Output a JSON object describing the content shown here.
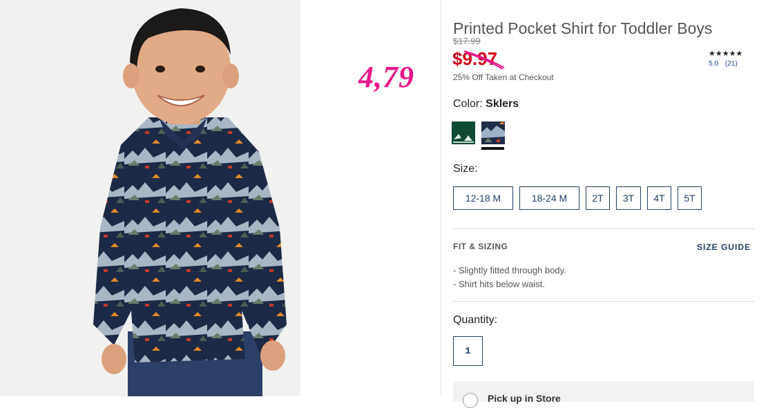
{
  "annotation": {
    "handwritten_price": "4,79"
  },
  "product": {
    "title": "Printed Pocket Shirt for Toddler Boys",
    "was_price": "$17.99",
    "sale_price": "$9.97",
    "promo": "25% Off Taken at Checkout",
    "sale_color": "#d0021b"
  },
  "rating": {
    "stars": "★★★★★",
    "score": "5.0",
    "count": "(21)"
  },
  "color": {
    "label": "Color:",
    "selected": "Sklers",
    "swatches": [
      {
        "name": "green-swatch",
        "selected": false
      },
      {
        "name": "sklers-print-swatch",
        "selected": true
      }
    ]
  },
  "size": {
    "label": "Size:",
    "options": [
      "12-18 M",
      "18-24 M",
      "2T",
      "3T",
      "4T",
      "5T"
    ]
  },
  "fit": {
    "heading": "FIT & SIZING",
    "size_guide": "SIZE GUIDE",
    "bullets": [
      "- Slightly fitted through body.",
      "- Shirt hits below waist."
    ]
  },
  "quantity": {
    "label": "Quantity:",
    "value": "1"
  },
  "pickup": {
    "label": "Pick up in Store"
  },
  "colors": {
    "accent": "#1f3f66",
    "sale": "#d0021b",
    "annotation": "#e8178a"
  }
}
